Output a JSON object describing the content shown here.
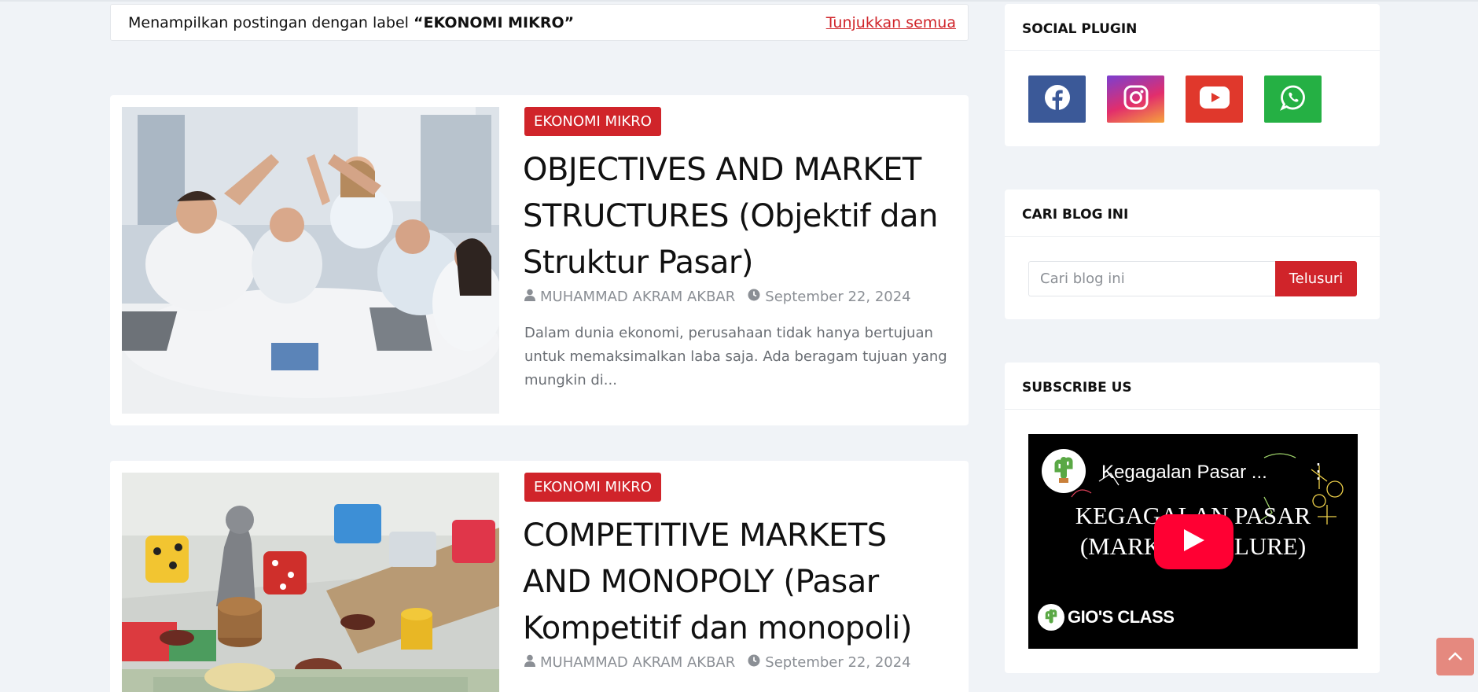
{
  "label_bar": {
    "prefix": "Menampilkan postingan dengan label ",
    "label": "“EKONOMI MIKRO”",
    "show_all": "Tunjukkan semua"
  },
  "posts": [
    {
      "tag": "EKONOMI MIKRO",
      "title": "OBJECTIVES AND MARKET STRUCTURES (Objektif dan Struktur Pasar)",
      "author": "MUHAMMAD AKRAM AKBAR",
      "date": "September 22, 2024",
      "excerpt": "Dalam dunia ekonomi, perusahaan tidak hanya bertujuan untuk memaksimalkan laba saja. Ada beragam tujuan yang mungkin di..."
    },
    {
      "tag": "EKONOMI MIKRO",
      "title": "COMPETITIVE MARKETS AND MONOPOLY (Pasar Kompetitif dan monopoli)",
      "author": "MUHAMMAD AKRAM AKBAR",
      "date": "September 22, 2024"
    }
  ],
  "sidebar": {
    "social": {
      "title": "SOCIAL PLUGIN",
      "icons": [
        "facebook-icon",
        "instagram-icon",
        "youtube-icon",
        "whatsapp-icon"
      ],
      "colors": [
        "#3b5998",
        "#e22e6c",
        "#e0382c",
        "#25b044"
      ]
    },
    "search": {
      "title": "CARI BLOG INI",
      "placeholder": "Cari blog ini",
      "button": "Telusuri"
    },
    "subscribe": {
      "title": "SUBSCRIBE US",
      "video_title": "Kegagalan Pasar ...",
      "video_heading_1": "KEGAGALAN PASAR",
      "video_heading_2": "(MARKET FAILURE)",
      "channel": "GIO'S CLASS"
    }
  },
  "colors": {
    "accent": "#d0242a",
    "background": "#f0f3f7",
    "back_to_top": "#e5897f"
  }
}
